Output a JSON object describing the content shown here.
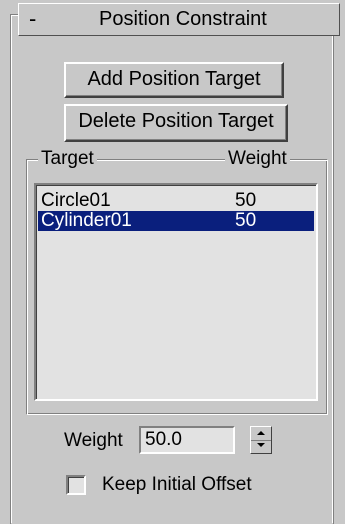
{
  "rollout": {
    "toggle": "-",
    "title": "Position Constraint"
  },
  "buttons": {
    "add_target": "Add Position Target",
    "delete_target": "Delete Position Target"
  },
  "target_list": {
    "columns": [
      "Target",
      "Weight"
    ],
    "rows": [
      {
        "name": "Circle01",
        "weight": "50",
        "selected": false
      },
      {
        "name": "Cylinder01",
        "weight": "50",
        "selected": true
      }
    ]
  },
  "weight_field": {
    "label": "Weight",
    "value": "50.0"
  },
  "keep_initial_offset": {
    "label": "Keep Initial Offset",
    "checked": false
  },
  "colors": {
    "panel_background": "#c8c8c8",
    "field_background": "#e2e2e2",
    "selection": "#0a1f7d"
  },
  "icons": {
    "spinner": "spinner-up-down-arrows-icon"
  }
}
